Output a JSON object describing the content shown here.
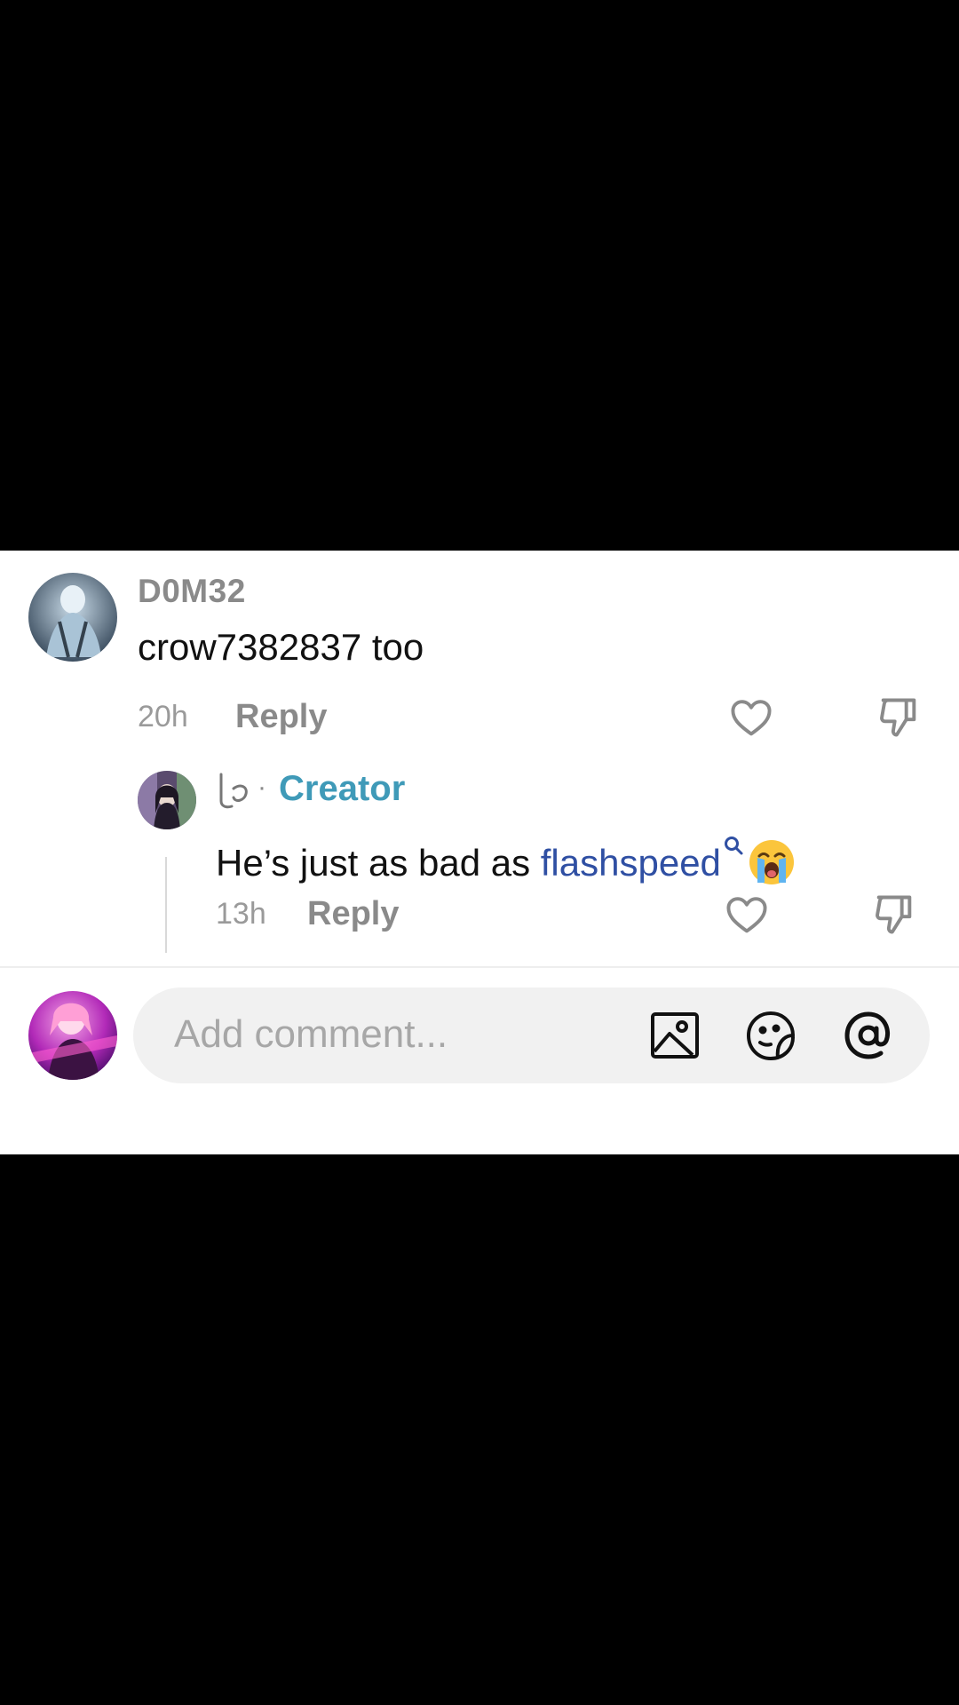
{
  "comment": {
    "username": "D0M32",
    "text": "crow7382837 too",
    "time": "20h",
    "reply_label": "Reply"
  },
  "reply_comment": {
    "separator": "·",
    "badge": "Creator",
    "text_prefix": "He’s just as bad as ",
    "mention": "flashspeed",
    "emoji": "loudly-crying-face",
    "time": "13h",
    "reply_label": "Reply"
  },
  "composer": {
    "placeholder": "Add comment..."
  },
  "icons": {
    "like": "heart-outline-icon",
    "dislike": "thumbs-down-icon",
    "image": "image-icon",
    "sticker": "emoji-sticker-icon",
    "mention": "at-sign-icon"
  },
  "colors": {
    "creator": "#3f9ab8",
    "mention": "#2f4fa3",
    "panel_bg": "#ffffff",
    "input_bg": "#f1f1f1"
  }
}
